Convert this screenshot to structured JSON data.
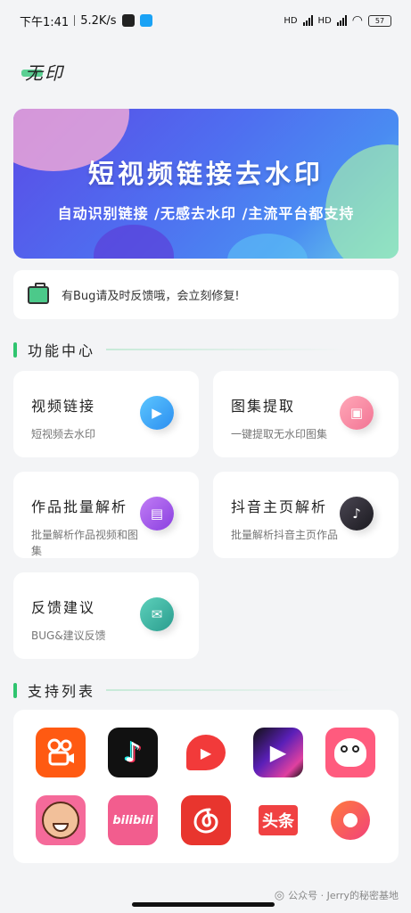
{
  "status_bar": {
    "time": "下午1:41",
    "speed": "5.2K/s",
    "signal1": "HD",
    "signal2": "HD",
    "battery": "57"
  },
  "app": {
    "title": "无印"
  },
  "banner": {
    "title": "短视频链接去水印",
    "subtitle": "自动识别链接 /无感去水印 /主流平台都支持"
  },
  "notice": {
    "text": "有Bug请及时反馈哦，会立刻修复!"
  },
  "features": {
    "section_title": "功能中心",
    "cards": [
      {
        "title": "视频链接",
        "subtitle": "短视频去水印",
        "icon": "play-icon",
        "color": "#3aa7f0"
      },
      {
        "title": "图集提取",
        "subtitle": "一键提取无水印图集",
        "icon": "image-icon",
        "color": "#f58aa3"
      },
      {
        "title": "作品批量解析",
        "subtitle": "批量解析作品视频和图集",
        "icon": "film-icon",
        "color": "#a45de8"
      },
      {
        "title": "抖音主页解析",
        "subtitle": "批量解析抖音主页作品",
        "icon": "tiktok-icon",
        "color": "#2b2b33"
      },
      {
        "title": "反馈建议",
        "subtitle": "BUG&建议反馈",
        "icon": "chat-icon",
        "color": "#3db8a5"
      }
    ]
  },
  "support": {
    "section_title": "支持列表",
    "platforms": [
      {
        "name": "kuaishou-icon",
        "label": "",
        "color": "#ff5a12"
      },
      {
        "name": "douyin-icon",
        "label": "♪",
        "color": "#111111"
      },
      {
        "name": "xigua-icon",
        "label": "▶",
        "color": "#f23a3a"
      },
      {
        "name": "weishi-icon",
        "label": "▶",
        "color": "#7a2fd6"
      },
      {
        "name": "pipixia-icon",
        "label": "",
        "color": "#ff5b7e"
      },
      {
        "name": "zuiyou-icon",
        "label": "",
        "color": "#f56a9a"
      },
      {
        "name": "bilibili-icon",
        "label": "bilibili",
        "color": "#f25d8e"
      },
      {
        "name": "netease-music-icon",
        "label": "",
        "color": "#e8352e"
      },
      {
        "name": "toutiao-icon",
        "label": "头条",
        "color": "#f04142"
      },
      {
        "name": "haokan-icon",
        "label": "",
        "color": "#f2427a"
      }
    ]
  },
  "watermark": {
    "text": "公众号 · Jerry的秘密基地"
  }
}
